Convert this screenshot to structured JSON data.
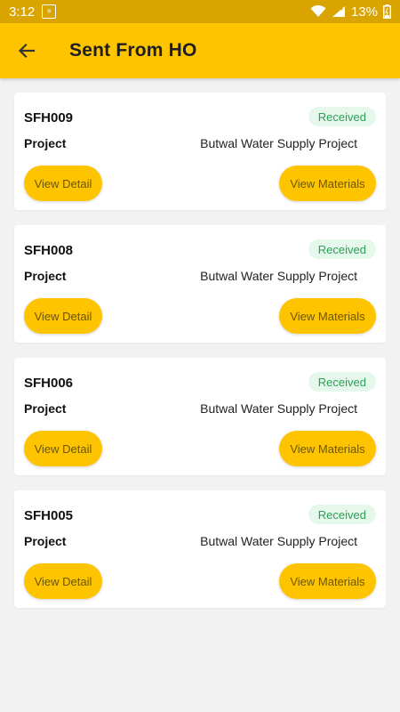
{
  "status_bar": {
    "time": "3:12",
    "battery": "13%",
    "notification_icon": "sim-notification-icon"
  },
  "app_bar": {
    "title": "Sent From HO",
    "back_icon": "back-arrow-icon"
  },
  "items": [
    {
      "code": "SFH009",
      "status": "Received",
      "project_label": "Project",
      "project": "Butwal Water Supply Project",
      "detail_button": "View Detail",
      "materials_button": "View Materials"
    },
    {
      "code": "SFH008",
      "status": "Received",
      "project_label": "Project",
      "project": "Butwal Water Supply Project",
      "detail_button": "View Detail",
      "materials_button": "View Materials"
    },
    {
      "code": "SFH006",
      "status": "Received",
      "project_label": "Project",
      "project": "Butwal Water Supply Project",
      "detail_button": "View Detail",
      "materials_button": "View Materials"
    },
    {
      "code": "SFH005",
      "status": "Received",
      "project_label": "Project",
      "project": "Butwal Water Supply Project",
      "detail_button": "View Detail",
      "materials_button": "View Materials"
    }
  ],
  "colors": {
    "accent": "#ffc400",
    "status_bar": "#d9a300",
    "status_received_bg": "#e6f7ec",
    "status_received_text": "#2e9f57"
  }
}
